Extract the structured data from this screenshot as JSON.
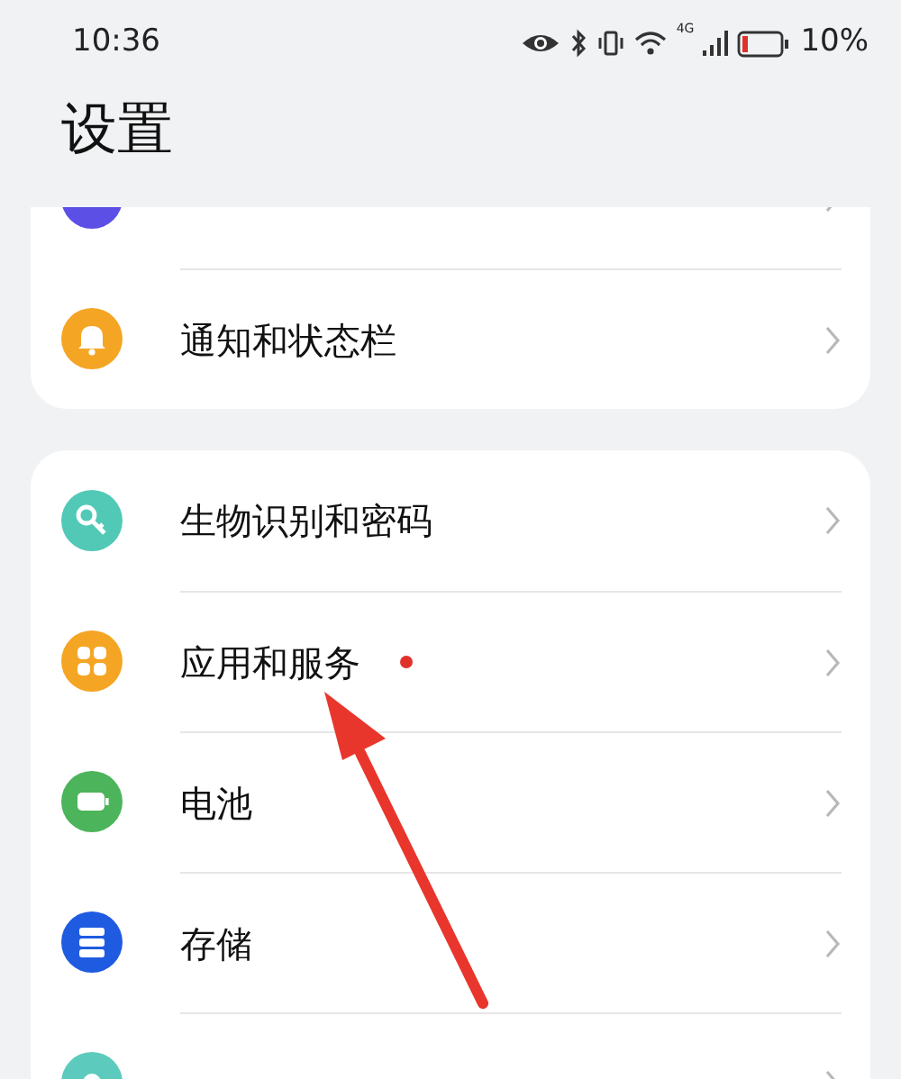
{
  "status_bar": {
    "time": "10:36",
    "network": "4G",
    "battery": "10%"
  },
  "title": "设置",
  "groups": [
    {
      "items": [
        {
          "color": "#5b4fe6",
          "badge": false
        },
        {
          "label": "通知和状态栏",
          "color": "#f5a524",
          "badge": false
        }
      ]
    },
    {
      "items": [
        {
          "label": "生物识别和密码",
          "color": "#52c9b7",
          "badge": false
        },
        {
          "label": "应用和服务",
          "color": "#f5a524",
          "badge": true
        },
        {
          "label": "电池",
          "color": "#4cb45a",
          "badge": false
        },
        {
          "label": "存储",
          "color": "#1f5be0",
          "badge": false
        },
        {
          "color": "#5ccbbd",
          "badge": false
        }
      ]
    }
  ],
  "annotation": {
    "kind": "arrow"
  }
}
